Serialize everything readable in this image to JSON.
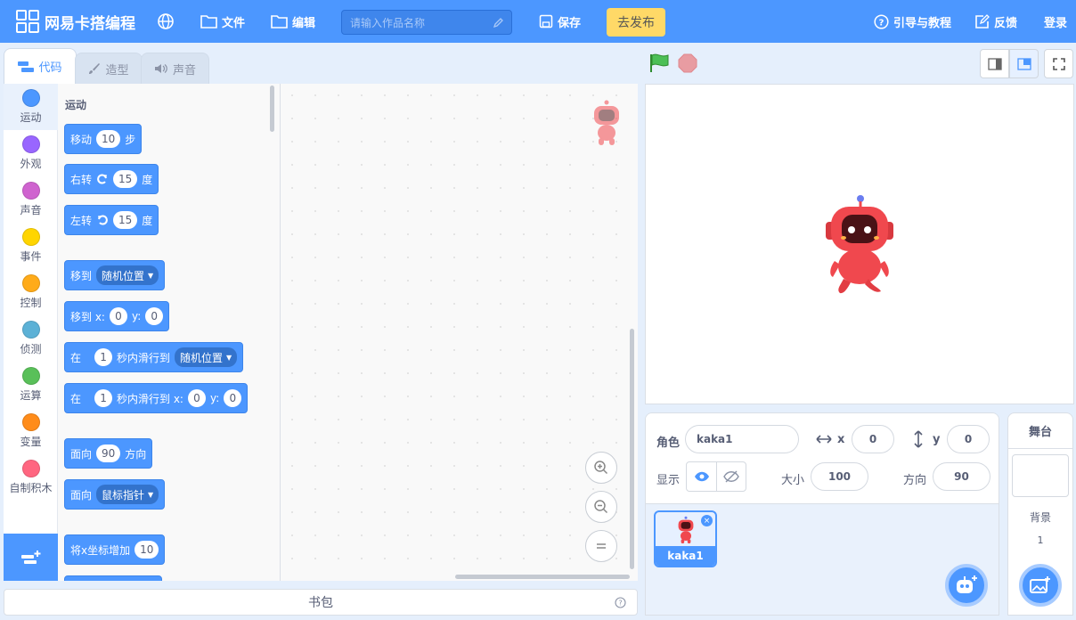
{
  "topbar": {
    "brand": "网易卡搭编程",
    "file_label": "文件",
    "edit_label": "编辑",
    "search_placeholder": "请输入作品名称",
    "save_label": "保存",
    "publish_label": "去发布",
    "tutorial_label": "引导与教程",
    "feedback_label": "反馈",
    "login_label": "登录"
  },
  "tabs": [
    {
      "label": "代码"
    },
    {
      "label": "造型"
    },
    {
      "label": "声音"
    }
  ],
  "categories": [
    {
      "label": "运动",
      "color": "#4c97ff"
    },
    {
      "label": "外观",
      "color": "#9966ff"
    },
    {
      "label": "声音",
      "color": "#cf63cf"
    },
    {
      "label": "事件",
      "color": "#ffd500"
    },
    {
      "label": "控制",
      "color": "#ffab19"
    },
    {
      "label": "侦测",
      "color": "#5cb1d6"
    },
    {
      "label": "运算",
      "color": "#59c059"
    },
    {
      "label": "变量",
      "color": "#ff8c1a"
    },
    {
      "label": "自制积木",
      "color": "#ff6680"
    }
  ],
  "palette": {
    "heading": "运动",
    "move": {
      "a": "移动",
      "v": "10",
      "b": "步"
    },
    "turn_right": {
      "a": "右转",
      "v": "15",
      "b": "度"
    },
    "turn_left": {
      "a": "左转",
      "v": "15",
      "b": "度"
    },
    "goto": {
      "a": "移到",
      "dd": "随机位置"
    },
    "goto_xy": {
      "a": "移到 x:",
      "x": "0",
      "b": "y:",
      "y": "0"
    },
    "glide": {
      "a": "在",
      "v": "1",
      "b": "秒内滑行到",
      "dd": "随机位置"
    },
    "glide_xy": {
      "a": "在",
      "v": "1",
      "b": "秒内滑行到 x:",
      "x": "0",
      "c": "y:",
      "y": "0"
    },
    "point": {
      "a": "面向",
      "v": "90",
      "b": "方向"
    },
    "point_towards": {
      "a": "面向",
      "dd": "鼠标指针"
    },
    "change_x": {
      "a": "将x坐标增加",
      "v": "10"
    }
  },
  "backpack_label": "书包",
  "sprite_info": {
    "sprite_label": "角色",
    "sprite_name": "kaka1",
    "x_label": "x",
    "x_value": "0",
    "y_label": "y",
    "y_value": "0",
    "show_label": "显示",
    "size_label": "大小",
    "size_value": "100",
    "direction_label": "方向",
    "direction_value": "90"
  },
  "sprites": [
    {
      "name": "kaka1"
    }
  ],
  "stage_panel": {
    "title": "舞台",
    "backdrop_label": "背景",
    "backdrop_count": "1"
  },
  "colors": {
    "accent": "#4c97ff",
    "publish": "#ffd967",
    "robot": "#f0484e"
  }
}
